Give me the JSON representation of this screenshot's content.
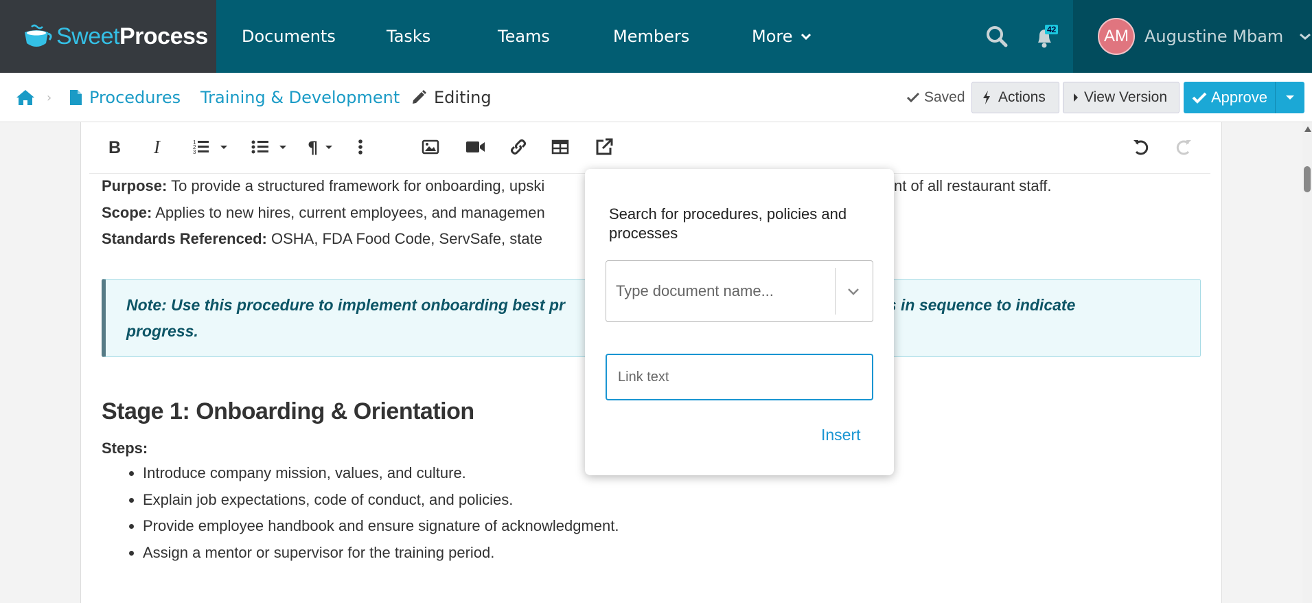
{
  "nav": {
    "logo_left": "Sweet",
    "logo_right": "Process",
    "items": [
      "Documents",
      "Tasks",
      "Teams",
      "Members",
      "More"
    ],
    "notification_count": "42",
    "user_initials": "AM",
    "user_name": "Augustine Mbam"
  },
  "breadcrumb": {
    "procedures": "Procedures",
    "category": "Training & Development",
    "current": "Editing"
  },
  "toolbar_actions": {
    "saved": "Saved",
    "actions": "Actions",
    "view_version": "View Version",
    "approve": "Approve"
  },
  "editor_tools": [
    "bold-icon",
    "italic-icon",
    "ordered-list-icon",
    "unordered-list-icon",
    "paragraph-icon",
    "more-vertical-icon",
    "image-icon",
    "video-icon",
    "link-icon",
    "table-icon",
    "external-link-icon",
    "undo-icon",
    "redo-icon"
  ],
  "content": {
    "purpose_label": "Purpose:",
    "purpose_text": " To provide a structured framework for onboarding, upski",
    "purpose_tail": "opment of all restaurant staff.",
    "scope_label": "Scope:",
    "scope_text": " Applies to new hires, current employees, and managemen",
    "standards_label": "Standards Referenced:",
    "standards_text": " OSHA, FDA Food Code, ServSafe, state",
    "note_line1_start": "Note: Use this procedure to implement onboarding best pr",
    "note_line1_end": "ists in sequence to indicate",
    "note_line2": "progress.",
    "stage_title": "Stage 1: Onboarding & Orientation",
    "steps_label": "Steps:",
    "steps": [
      "Introduce company mission, values, and culture.",
      "Explain job expectations, code of conduct, and policies.",
      "Provide employee handbook and ensure signature of acknowledgment.",
      "Assign a mentor or supervisor for the training period."
    ]
  },
  "popup": {
    "title": "Search for procedures, policies and processes",
    "select_placeholder": "Type document name...",
    "link_text_placeholder": "Link text",
    "insert": "Insert"
  },
  "colors": {
    "nav_bg": "#025d72",
    "logo_bg": "#363a3f",
    "user_bg": "#024c5d",
    "link": "#1a9bc6",
    "approve": "#1ba8d6",
    "note_text": "#0d5566"
  }
}
